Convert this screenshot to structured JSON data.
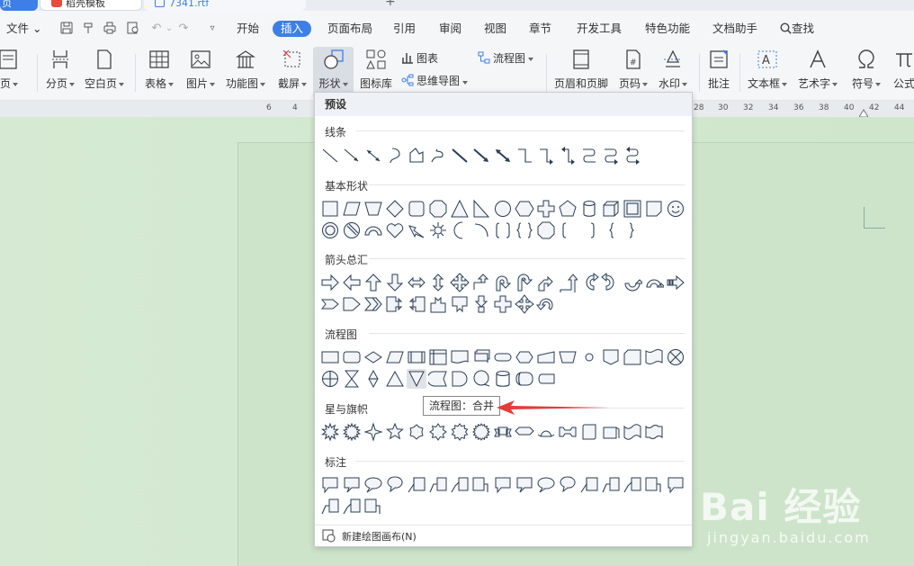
{
  "tabs": {
    "home_label": "页",
    "template_label": "稻壳模板",
    "doc_label": "7341.rtf"
  },
  "menubar": {
    "file_label": "文件",
    "items": [
      "开始",
      "插入",
      "页面布局",
      "引用",
      "审阅",
      "视图",
      "章节",
      "开发工具",
      "特色功能",
      "文档助手"
    ],
    "active_item": "插入",
    "search_label": "查找"
  },
  "ribbon": {
    "page_label": "页",
    "break_label": "分页",
    "blank_page_label": "空白页",
    "table_label": "表格",
    "picture_label": "图片",
    "function_chart_label": "功能图",
    "screenshot_label": "截屏",
    "shapes_label": "形状",
    "icon_lib_label": "图标库",
    "chart_label": "图表",
    "mindmap_label": "思维导图",
    "flowchart_label": "流程图",
    "header_footer_label": "页眉和页脚",
    "page_number_label": "页码",
    "watermark_label": "水印",
    "comment_label": "批注",
    "textbox_label": "文本框",
    "wordart_label": "艺术字",
    "symbol_label": "符号",
    "formula_label": "公式"
  },
  "ruler": {
    "left_ticks": [
      "6",
      "4"
    ],
    "right_ticks": [
      "28",
      "30",
      "32",
      "34",
      "36",
      "38",
      "40",
      "42",
      "44"
    ]
  },
  "shape_panel": {
    "header": "预设",
    "categories": {
      "lines": "线条",
      "basic": "基本形状",
      "arrows": "箭头总汇",
      "flowchart": "流程图",
      "stars": "星与旗帜",
      "callouts": "标注"
    },
    "new_canvas_label": "新建绘图画布(N)",
    "tooltip": "流程图：合并"
  },
  "watermark": {
    "logo_text": "Bai 经验",
    "url": "jingyan.baidu.com"
  },
  "colors": {
    "accent": "#3d7fe6",
    "arrow": "#e83a3a",
    "doc_background": "#cfe6cc"
  }
}
